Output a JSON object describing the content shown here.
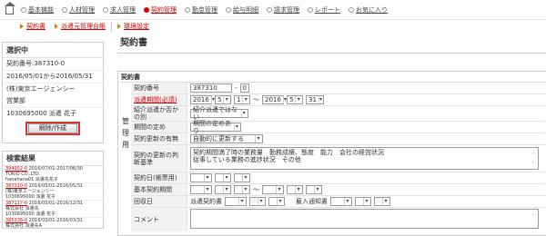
{
  "nav": {
    "items": [
      {
        "label": "基本機能",
        "active": false
      },
      {
        "label": "人材管理",
        "active": false
      },
      {
        "label": "求人管理",
        "active": false
      },
      {
        "label": "契約管理",
        "active": true
      },
      {
        "label": "勤怠管理",
        "active": false
      },
      {
        "label": "給与明細",
        "active": false
      },
      {
        "label": "請求管理",
        "active": false
      },
      {
        "label": "レポート",
        "active": false
      },
      {
        "label": "お気に入り",
        "active": false
      }
    ]
  },
  "subnav": {
    "items": [
      "契約書",
      "派遣元管理台帳",
      "環境設定"
    ]
  },
  "left": {
    "selected": {
      "heading": "選択中",
      "contract_no": "契約番号:387310-0",
      "period": "2016/05/01から2016/05/31",
      "company": "(株)東京エージェンシー",
      "dept": "営業部",
      "person": "1030695000 派遣 花子",
      "release_button": "解除/作成"
    },
    "results": {
      "heading": "検索結果",
      "items": [
        {
          "link": "394952-0",
          "date": "2016/07/01-2017/06/30",
          "company": "TOKIO CO.,LTD.",
          "person": "hanahana01 派遣先花子"
        },
        {
          "link": "387310-0",
          "date": "2016/05/01-2016/05/31",
          "company": "(株)東京エージェンシー",
          "person": "1030695000 派遣 花子"
        },
        {
          "link": "387117-0",
          "date": "2016/05/01-2016/12/31",
          "company": "株式会社 派遣先",
          "person": "1030695000 派遣 花子"
        },
        {
          "link": "385335-0",
          "date": "2016/03/01-2016/03/31",
          "company": "株式会社 派遣先A",
          "person": ""
        }
      ]
    }
  },
  "main": {
    "title": "契約書",
    "section_heading": "契約書",
    "kanri_label": "管理用",
    "fields": {
      "contract_no_label": "契約番号",
      "contract_no_value": "387310",
      "contract_no_branch": "0",
      "period_label": "派遣期間(必須)",
      "period_from": {
        "year": "2016",
        "month": "5",
        "day": "1"
      },
      "period_to": {
        "year": "2016",
        "month": "5",
        "day": "31"
      },
      "intro_label": "紹介派遣か否かの別",
      "intro_value": "紹介派遣ではない",
      "term_label": "期間の定め",
      "term_value": "期間の定めあり",
      "renewal_label": "契約更新の有無",
      "renewal_value": "自動的に更新する",
      "criteria_label": "契約の更新の判断基準",
      "criteria_lines": [
        "契約期間満了時の業務量　勤務成績、態度　能力　会社の経営状況",
        "従事している業務の進捗状況　その他"
      ],
      "sign_date_label": "契約日(帳票用)",
      "base_period_label": "基本契約期間",
      "collect_label": "回収日",
      "dispatch_doc_label": "派遣契約書",
      "notice_doc_label": "雇入通知書",
      "comment_label": "コメント"
    }
  },
  "colors": {
    "accent": "#cc0000",
    "label_bg": "#f2f2f2",
    "border": "#cccccc"
  }
}
